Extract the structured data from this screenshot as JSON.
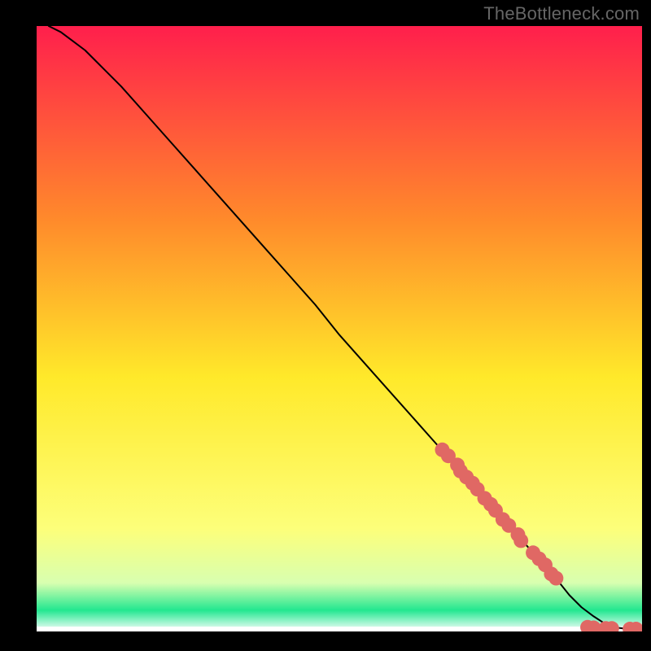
{
  "watermark": "TheBottleneck.com",
  "colors": {
    "background": "#000000",
    "gradient_top": "#ff1f4c",
    "gradient_mid1": "#ff8a2b",
    "gradient_mid2": "#ffe92a",
    "gradient_mid3": "#fdff7a",
    "gradient_mid4": "#d8ffb0",
    "gradient_bottom": "#22e790",
    "curve": "#000000",
    "marker": "#e06864"
  },
  "chart_data": {
    "type": "line",
    "title": "",
    "xlabel": "",
    "ylabel": "",
    "xlim": [
      0,
      100
    ],
    "ylim": [
      0,
      100
    ],
    "series": [
      {
        "name": "bottleneck-curve",
        "x": [
          2,
          4,
          6,
          8,
          10,
          14,
          18,
          22,
          26,
          30,
          34,
          38,
          42,
          46,
          50,
          54,
          58,
          62,
          66,
          70,
          74,
          78,
          82,
          86,
          88,
          90,
          92,
          94,
          96,
          98,
          100
        ],
        "y": [
          100,
          99,
          97.5,
          96,
          94,
          90,
          85.5,
          81,
          76.5,
          72,
          67.5,
          63,
          58.5,
          54,
          49,
          44.5,
          40,
          35.5,
          31,
          26.5,
          22,
          17.5,
          13,
          8.5,
          6,
          4,
          2.5,
          1.2,
          0.6,
          0.4,
          0.4
        ]
      }
    ],
    "markers": {
      "name": "highlighted-points",
      "x": [
        67,
        68,
        69.5,
        70,
        71,
        72,
        72.8,
        74,
        75,
        75.8,
        77,
        78,
        79.5,
        80,
        82,
        83,
        84,
        85,
        85.8,
        91,
        92,
        94,
        95,
        98,
        99
      ],
      "y": [
        30,
        29,
        27.5,
        26.5,
        25.5,
        24.5,
        23.5,
        22,
        21,
        20,
        18.5,
        17.5,
        16,
        15,
        13,
        12,
        11,
        9.5,
        8.8,
        0.7,
        0.6,
        0.5,
        0.5,
        0.4,
        0.4
      ]
    }
  }
}
